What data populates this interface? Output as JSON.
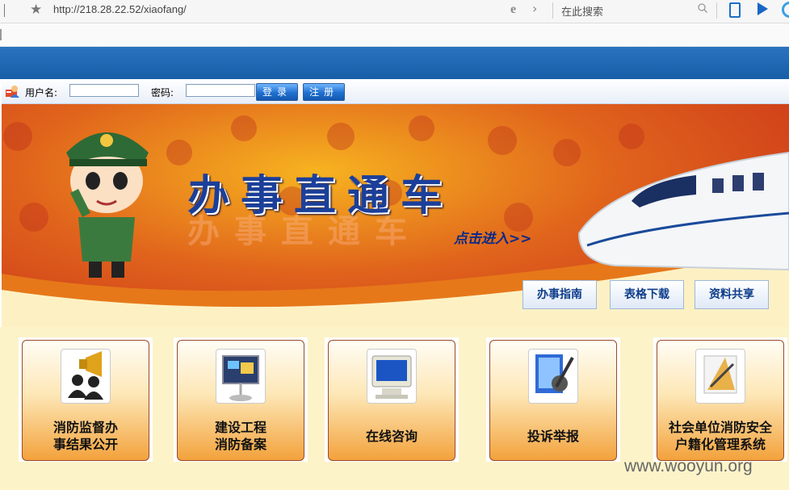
{
  "browser": {
    "url": "http://218.28.22.52/xiaofang/",
    "search_placeholder": "在此搜索"
  },
  "login": {
    "username_label": "用户名:",
    "password_label": "密码:",
    "username_value": "",
    "password_value": "",
    "login_button": "登录",
    "register_button": "注册"
  },
  "banner": {
    "title": "办事直通车",
    "enter_link": "点击进入>>",
    "nav": [
      {
        "label": "办事指南"
      },
      {
        "label": "表格下载"
      },
      {
        "label": "资料共享"
      }
    ]
  },
  "tiles": [
    {
      "line1": "消防监督办",
      "line2": "事结果公开",
      "icon": "megaphone-people-icon"
    },
    {
      "line1": "建设工程",
      "line2": "消防备案",
      "icon": "easel-board-icon"
    },
    {
      "line1": "在线咨询",
      "line2": "",
      "icon": "computer-monitor-icon"
    },
    {
      "line1": "投诉举报",
      "line2": "",
      "icon": "pen-document-icon"
    },
    {
      "line1": "社会单位消防安全",
      "line2": "户籍化管理系统",
      "icon": "drafting-tools-icon"
    }
  ],
  "watermark": "www.wooyun.org",
  "colors": {
    "header_blue": "#1b62ad",
    "title_blue": "#1b3f9a",
    "tile_orange": "#f3a23c"
  }
}
